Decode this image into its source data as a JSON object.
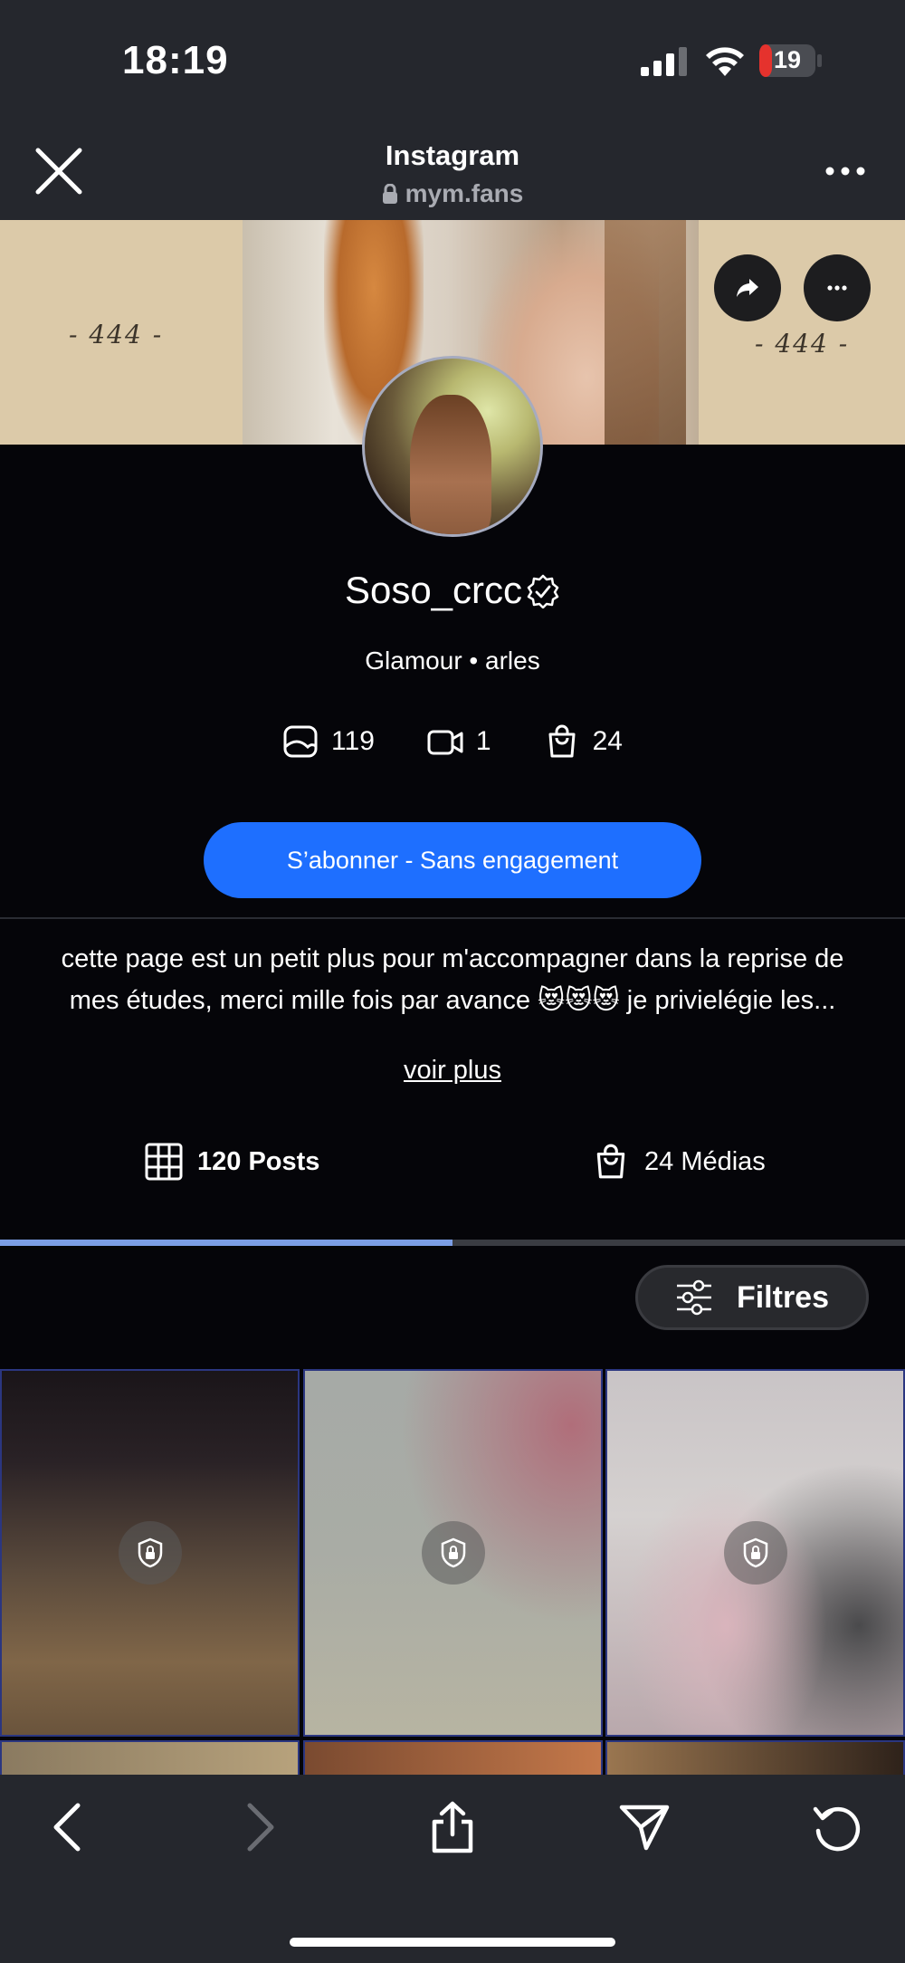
{
  "status_bar": {
    "time": "18:19",
    "battery_level": "19",
    "battery_color": "#e5322d"
  },
  "browser": {
    "title": "Instagram",
    "url": "mym.fans"
  },
  "cover": {
    "left_text": "- 444 -",
    "right_text": "- 444 -"
  },
  "profile": {
    "username": "Soso_crcc",
    "subtitle": "Glamour • arles",
    "stats": {
      "photos": "119",
      "videos": "1",
      "purchases": "24"
    },
    "subscribe_label": "S’abonner - Sans engagement",
    "bio_line1": "cette page est un petit plus pour m'accompagner dans la reprise de",
    "bio_line2": "mes études, merci mille fois par avance 😻😻😻 je privielégie les...",
    "see_more": "voir plus"
  },
  "tabs": {
    "posts_label": "120 Posts",
    "media_label": "24 Médias",
    "active": "posts",
    "accent": "#7c9ee5"
  },
  "filters_label": "Filtres",
  "accent_color": "#1e6fff",
  "icons": {
    "close": "close-icon",
    "more": "ellipsis-icon",
    "share": "share-arrow-icon",
    "verified": "verified-badge-icon",
    "photo": "photo-icon",
    "video": "video-camera-icon",
    "bag": "shopping-bag-icon",
    "grid": "grid-icon",
    "filters": "sliders-icon",
    "lock": "lock-shield-icon",
    "back": "chevron-left-icon",
    "forward": "chevron-right-icon",
    "upload": "share-upload-icon",
    "send": "send-icon",
    "reload": "reload-icon"
  }
}
